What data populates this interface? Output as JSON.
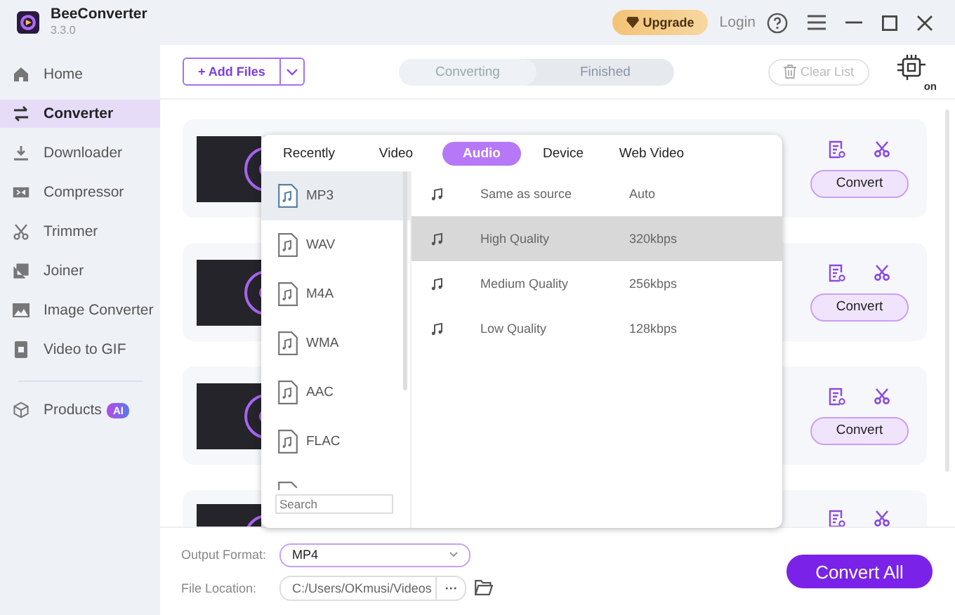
{
  "app": {
    "name": "BeeConverter",
    "version": "3.3.0"
  },
  "header": {
    "upgrade": "Upgrade",
    "login": "Login"
  },
  "sidebar": {
    "items": [
      {
        "label": "Home",
        "selected": false
      },
      {
        "label": "Converter",
        "selected": true
      },
      {
        "label": "Downloader",
        "selected": false
      },
      {
        "label": "Compressor",
        "selected": false
      },
      {
        "label": "Trimmer",
        "selected": false
      },
      {
        "label": "Joiner",
        "selected": false
      },
      {
        "label": "Image Converter",
        "selected": false
      },
      {
        "label": "Video to GIF",
        "selected": false
      }
    ],
    "products": {
      "label": "Products",
      "badge": "AI"
    }
  },
  "toolbar": {
    "add_files": "+ Add Files",
    "tabs": [
      {
        "label": "Converting",
        "selected": true
      },
      {
        "label": "Finished",
        "selected": false
      }
    ],
    "clear_list": "Clear List",
    "gpu_label": "on"
  },
  "files": [
    {
      "kind": "full",
      "convert": "Convert"
    },
    {
      "kind": "full",
      "convert": "Convert"
    },
    {
      "kind": "full",
      "convert": "Convert"
    },
    {
      "kind": "cut"
    }
  ],
  "format_popup": {
    "tabs": [
      {
        "label": "Recently",
        "selected": false
      },
      {
        "label": "Video",
        "selected": false
      },
      {
        "label": "Audio",
        "selected": true
      },
      {
        "label": "Device",
        "selected": false
      },
      {
        "label": "Web Video",
        "selected": false
      }
    ],
    "formats": [
      {
        "label": "MP3",
        "selected": true
      },
      {
        "label": "WAV",
        "selected": false
      },
      {
        "label": "M4A",
        "selected": false
      },
      {
        "label": "WMA",
        "selected": false
      },
      {
        "label": "AAC",
        "selected": false
      },
      {
        "label": "FLAC",
        "selected": false
      }
    ],
    "search": {
      "placeholder": "Search"
    },
    "qualities": [
      {
        "name": "Same as source",
        "value": "Auto",
        "selected": false
      },
      {
        "name": "High Quality",
        "value": "320kbps",
        "selected": true
      },
      {
        "name": "Medium Quality",
        "value": "256kbps",
        "selected": false
      },
      {
        "name": "Low Quality",
        "value": "128kbps",
        "selected": false
      }
    ]
  },
  "bottom": {
    "output_format": {
      "label": "Output Format:",
      "value": "MP4"
    },
    "file_location": {
      "label": "File Location:",
      "value": "C:/Users/OKmusi/Videos",
      "more": "···"
    },
    "convert_all": "Convert All"
  }
}
